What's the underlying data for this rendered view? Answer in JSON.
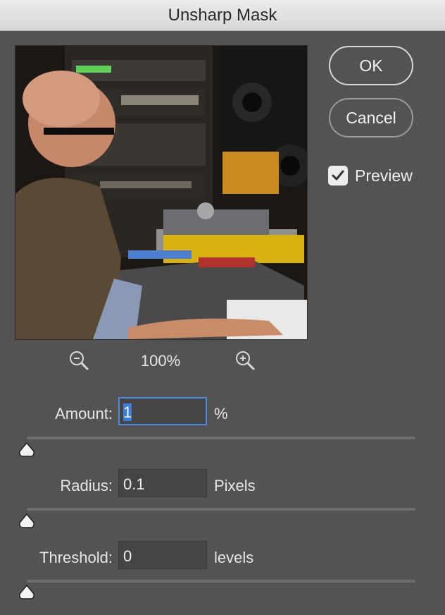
{
  "dialog": {
    "title": "Unsharp Mask"
  },
  "buttons": {
    "ok": "OK",
    "cancel": "Cancel"
  },
  "preview_toggle": {
    "label": "Preview",
    "checked": true
  },
  "zoom": {
    "level": "100%"
  },
  "amount": {
    "label": "Amount:",
    "value": "1",
    "unit": "%",
    "slider_fraction": 0.0
  },
  "radius": {
    "label": "Radius:",
    "value": "0.1",
    "unit": "Pixels",
    "slider_fraction": 0.0
  },
  "threshold": {
    "label": "Threshold:",
    "value": "0",
    "unit": "levels",
    "slider_fraction": 0.0
  },
  "colors": {
    "dialog_bg": "#535353",
    "field_bg": "#454545",
    "focus_ring": "#4d8ae0",
    "selection": "#3c7ed6"
  }
}
